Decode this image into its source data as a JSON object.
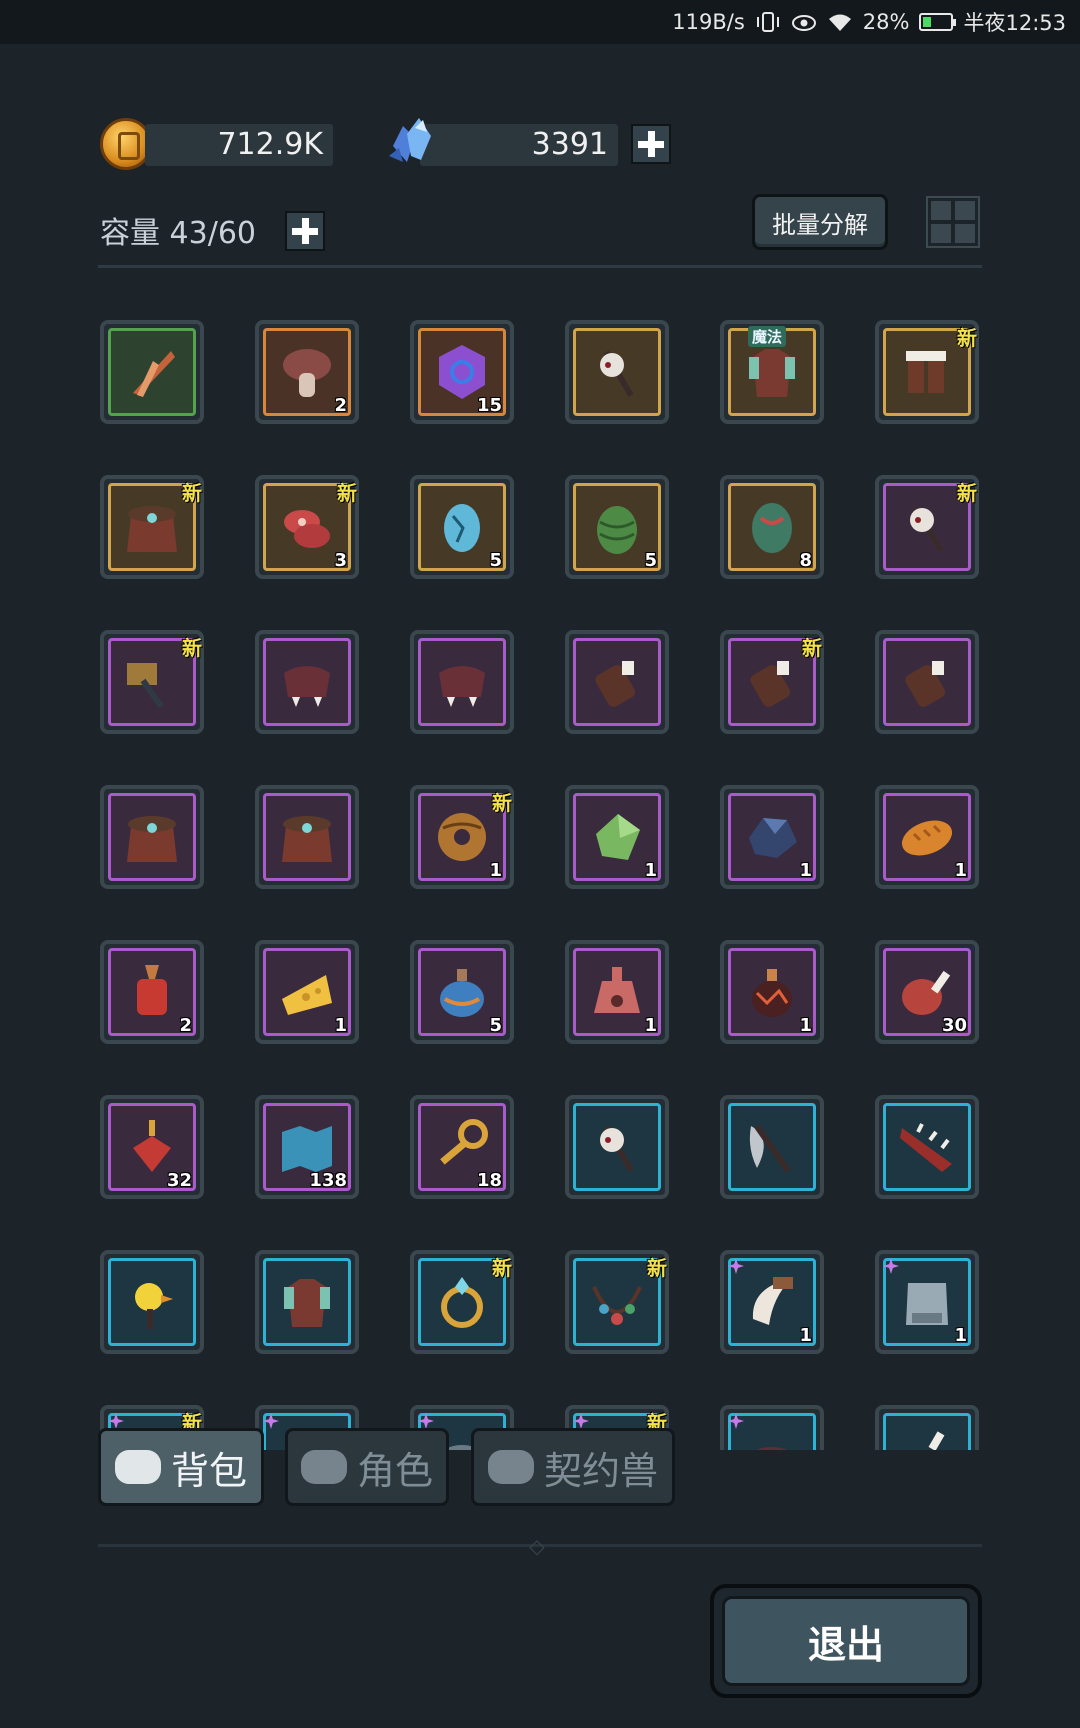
{
  "status_bar": {
    "speed": "119B/s",
    "battery": "28%",
    "time": "半夜12:53"
  },
  "currency": {
    "gold": "712.9K",
    "gems": "3391"
  },
  "inventory_header": {
    "capacity": "容量 43/60",
    "batch_disassemble": "批量分解"
  },
  "items": [
    {
      "art": "feather-blade",
      "rarity": "green",
      "count": "",
      "new": "",
      "tag": ""
    },
    {
      "art": "mushroom",
      "rarity": "orange",
      "count": "2",
      "new": "",
      "tag": ""
    },
    {
      "art": "purple-rune-stone",
      "rarity": "orange",
      "count": "15",
      "new": "",
      "tag": ""
    },
    {
      "art": "skull-staff",
      "rarity": "gold",
      "count": "",
      "new": "",
      "tag": ""
    },
    {
      "art": "robe-armor",
      "rarity": "gold",
      "count": "",
      "new": "",
      "tag": "魔法"
    },
    {
      "art": "fur-boots",
      "rarity": "gold",
      "count": "",
      "new": "新",
      "tag": ""
    },
    {
      "art": "fur-cloak",
      "rarity": "gold",
      "count": "",
      "new": "新",
      "tag": ""
    },
    {
      "art": "raw-meat",
      "rarity": "gold",
      "count": "3",
      "new": "新",
      "tag": ""
    },
    {
      "art": "blue-egg",
      "rarity": "gold",
      "count": "5",
      "new": "",
      "tag": ""
    },
    {
      "art": "green-cone",
      "rarity": "gold",
      "count": "5",
      "new": "",
      "tag": ""
    },
    {
      "art": "dragon-egg",
      "rarity": "gold",
      "count": "8",
      "new": "",
      "tag": ""
    },
    {
      "art": "skull-staff",
      "rarity": "purple",
      "count": "",
      "new": "新",
      "tag": ""
    },
    {
      "art": "war-hammer",
      "rarity": "purple",
      "count": "",
      "new": "新",
      "tag": ""
    },
    {
      "art": "fang-helm",
      "rarity": "purple",
      "count": "",
      "new": "",
      "tag": ""
    },
    {
      "art": "fang-helm",
      "rarity": "purple",
      "count": "",
      "new": "",
      "tag": ""
    },
    {
      "art": "bracer",
      "rarity": "purple",
      "count": "",
      "new": "",
      "tag": ""
    },
    {
      "art": "bracer",
      "rarity": "purple",
      "count": "",
      "new": "新",
      "tag": ""
    },
    {
      "art": "bracer",
      "rarity": "purple",
      "count": "",
      "new": "",
      "tag": ""
    },
    {
      "art": "fur-cloak",
      "rarity": "purple",
      "count": "",
      "new": "",
      "tag": ""
    },
    {
      "art": "fur-cloak",
      "rarity": "purple",
      "count": "",
      "new": "",
      "tag": ""
    },
    {
      "art": "wood-ring",
      "rarity": "purple",
      "count": "1",
      "new": "新",
      "tag": ""
    },
    {
      "art": "green-crystal",
      "rarity": "purple",
      "count": "1",
      "new": "",
      "tag": ""
    },
    {
      "art": "blue-ore",
      "rarity": "purple",
      "count": "1",
      "new": "",
      "tag": ""
    },
    {
      "art": "bread",
      "rarity": "purple",
      "count": "1",
      "new": "",
      "tag": ""
    },
    {
      "art": "red-lantern",
      "rarity": "purple",
      "count": "2",
      "new": "",
      "tag": ""
    },
    {
      "art": "cheese",
      "rarity": "purple",
      "count": "1",
      "new": "",
      "tag": ""
    },
    {
      "art": "blue-potion",
      "rarity": "purple",
      "count": "5",
      "new": "",
      "tag": ""
    },
    {
      "art": "paw-potion",
      "rarity": "purple",
      "count": "1",
      "new": "",
      "tag": ""
    },
    {
      "art": "lava-potion",
      "rarity": "purple",
      "count": "1",
      "new": "",
      "tag": ""
    },
    {
      "art": "ham",
      "rarity": "purple",
      "count": "30",
      "new": "",
      "tag": ""
    },
    {
      "art": "ruby-pendant",
      "rarity": "purple",
      "count": "32",
      "new": "",
      "tag": ""
    },
    {
      "art": "blue-map",
      "rarity": "purple",
      "count": "138",
      "new": "",
      "tag": ""
    },
    {
      "art": "gold-key",
      "rarity": "purple",
      "count": "18",
      "new": "",
      "tag": ""
    },
    {
      "art": "skull-staff",
      "rarity": "cyan",
      "count": "",
      "new": "",
      "tag": ""
    },
    {
      "art": "battle-axe",
      "rarity": "cyan",
      "count": "",
      "new": "",
      "tag": ""
    },
    {
      "art": "spiked-blade",
      "rarity": "cyan",
      "count": "",
      "new": "",
      "tag": ""
    },
    {
      "art": "duck-wand",
      "rarity": "cyan",
      "count": "",
      "new": "",
      "tag": ""
    },
    {
      "art": "robe-armor",
      "rarity": "cyan",
      "count": "",
      "new": "",
      "tag": ""
    },
    {
      "art": "gem-ring",
      "rarity": "cyan",
      "count": "",
      "new": "新",
      "tag": ""
    },
    {
      "art": "bead-necklace",
      "rarity": "cyan",
      "count": "",
      "new": "新",
      "tag": ""
    },
    {
      "art": "tusk",
      "rarity": "cyan",
      "count": "1",
      "new": "",
      "tag": "star"
    },
    {
      "art": "stone-armor",
      "rarity": "cyan",
      "count": "1",
      "new": "",
      "tag": "star"
    },
    {
      "art": "pot",
      "rarity": "cyan",
      "count": "",
      "new": "新",
      "tag": "star"
    },
    {
      "art": "belt",
      "rarity": "cyan",
      "count": "",
      "new": "",
      "tag": "star"
    },
    {
      "art": "belt",
      "rarity": "cyan",
      "count": "",
      "new": "",
      "tag": "star"
    },
    {
      "art": "collar",
      "rarity": "cyan",
      "count": "",
      "new": "新",
      "tag": "star"
    },
    {
      "art": "collar",
      "rarity": "cyan",
      "count": "",
      "new": "",
      "tag": "star"
    },
    {
      "art": "drumstick",
      "rarity": "cyan",
      "count": "",
      "new": "",
      "tag": ""
    }
  ],
  "tabs": [
    {
      "label": "背包",
      "icon": "bag-icon",
      "active": true
    },
    {
      "label": "角色",
      "icon": "character-icon",
      "active": false
    },
    {
      "label": "契约兽",
      "icon": "paw-icon",
      "active": false
    }
  ],
  "exit_label": "退出",
  "colors": {
    "purple": "#a85bc9",
    "orange": "#d7873c",
    "gold": "#d2a44b",
    "green": "#54a24e",
    "cyan": "#2cb3d3",
    "new_tag": "#f3e24a"
  }
}
